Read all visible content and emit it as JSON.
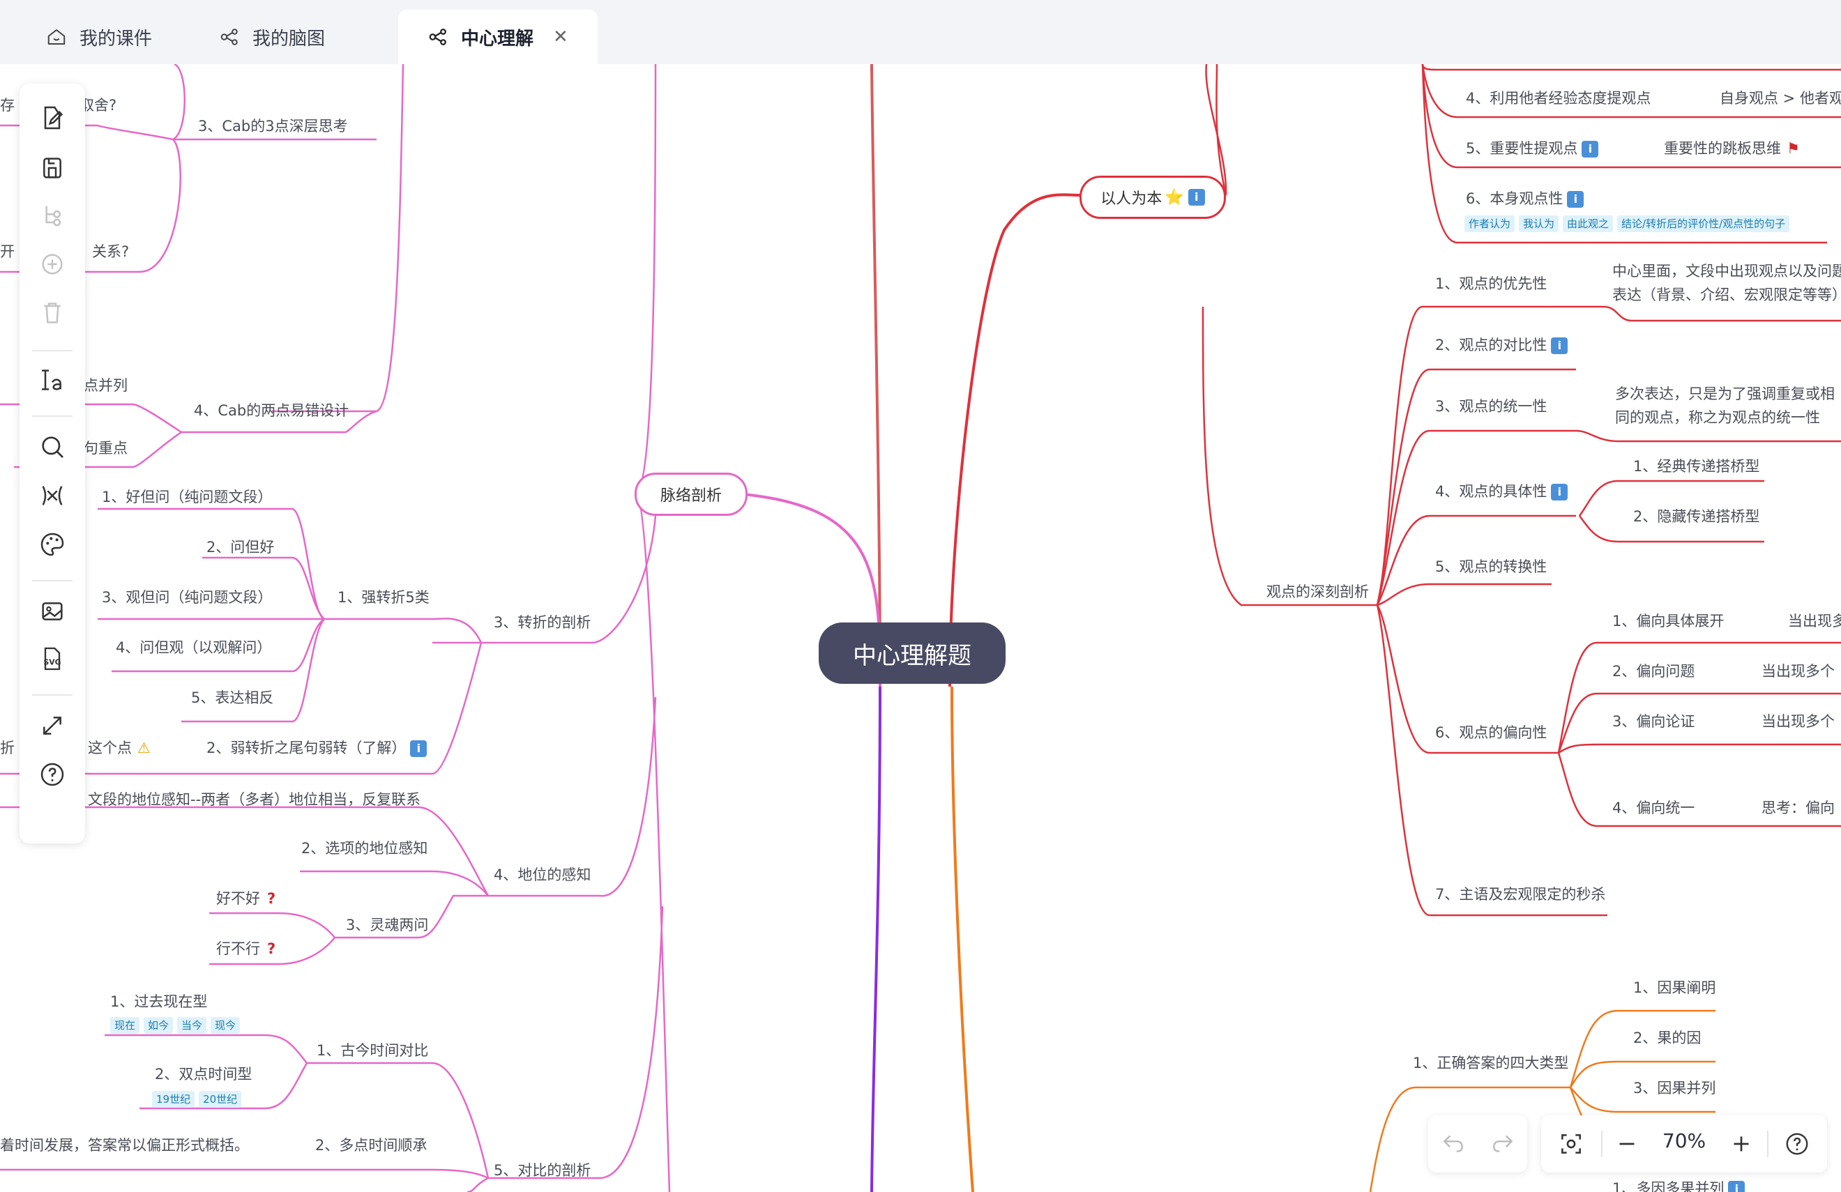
{
  "tabs": [
    {
      "label": "我的课件",
      "icon": "home-icon"
    },
    {
      "label": "我的脑图",
      "icon": "mindmap-icon"
    },
    {
      "label": "中心理解",
      "icon": "mindmap-icon",
      "active": true
    }
  ],
  "root": "中心理解题",
  "left": {
    "main_nodes": {
      "mailuo": "脉络剖析"
    },
    "cab": {
      "deep": "3、Cab的3点深层思考",
      "easy": "4、Cab的两点易错设计",
      "frag_1": "存",
      "frag_2": "取舍?",
      "frag_3": "开",
      "frag_4": "关系?",
      "frag_5": "点并列",
      "frag_6": "句重点"
    },
    "zhuanzhe": {
      "title": "3、转折的剖析",
      "strong": "1、强转折5类",
      "items": [
        "1、好但问（纯问题文段）",
        "2、问但好",
        "3、观但问（纯问题文段）",
        "4、问但观（以观解问）",
        "5、表达相反"
      ],
      "weak": "2、弱转折之尾句弱转（了解）",
      "frag_a": "折",
      "frag_b": "这个点"
    },
    "diwei": {
      "title": "4、地位的感知",
      "item1": "文段的地位感知--两者（多者）地位相当，反复联系",
      "item2": "2、选项的地位感知",
      "soul": "3、灵魂两问",
      "q1": "好不好",
      "q2": "行不行"
    },
    "duibi": {
      "title": "5、对比的剖析",
      "ancient": "1、古今时间对比",
      "past_now": "1、过去现在型",
      "past_tags": [
        "现在",
        "如今",
        "当今",
        "现今"
      ],
      "two_point": "2、双点时间型",
      "two_tags": [
        "19世纪",
        "20世纪"
      ],
      "multi": "2、多点时间顺承",
      "multi_desc": "着时间发展，答案常以偏正形式概括。"
    }
  },
  "right": {
    "yirenweiben": {
      "title": "以人为本",
      "item4": "4、利用他者经验态度提观点",
      "item4_note": "自身观点 > 他者观",
      "item5": "5、重要性提观点",
      "item5_note": "重要性的跳板思维",
      "item6": "6、本身观点性",
      "item6_tags": [
        "作者认为",
        "我认为",
        "由此观之",
        "结论/转折后的评价性/观点性的句子"
      ]
    },
    "guandian": {
      "title": "观点的深刻剖析",
      "item1": "1、观点的优先性",
      "item1_note_l1": "中心里面，文段中出现观点以及问题",
      "item1_note_l2": "表达（背景、介绍、宏观限定等等）",
      "item2": "2、观点的对比性",
      "item3": "3、观点的统一性",
      "item3_note_l1": "多次表达，只是为了强调重复或相",
      "item3_note_l2": "同的观点，称之为观点的统一性",
      "item4": "4、观点的具体性",
      "item4_sub": [
        "1、经典传递搭桥型",
        "2、隐藏传递搭桥型"
      ],
      "item5": "5、观点的转换性",
      "item6": "6、观点的偏向性",
      "item6_sub": [
        "1、偏向具体展开",
        "2、偏向问题",
        "3、偏向论证",
        "4、偏向统一"
      ],
      "item6_notes": [
        "当出现多",
        "当出现多个",
        "当出现多个",
        "思考：偏向"
      ],
      "item7": "7、主语及宏观限定的秒杀"
    },
    "zhengque": {
      "title": "1、正确答案的四大类型",
      "items": [
        "1、因果阐明",
        "2、果的因",
        "3、因果并列"
      ],
      "frag": "1、多因多果并列"
    }
  },
  "toolbar": {
    "buttons": [
      {
        "name": "edit-icon"
      },
      {
        "name": "save-icon"
      },
      {
        "name": "add-child-icon"
      },
      {
        "name": "add-node-icon"
      },
      {
        "name": "delete-icon"
      },
      {
        "name": "text-style-icon"
      },
      {
        "name": "search-icon"
      },
      {
        "name": "structure-icon"
      },
      {
        "name": "palette-icon"
      },
      {
        "name": "image-icon"
      },
      {
        "name": "svg-export-icon"
      },
      {
        "name": "fullscreen-icon"
      },
      {
        "name": "help-icon"
      }
    ],
    "svg_label": "SVG"
  },
  "zoom": {
    "value": "70%"
  },
  "colors": {
    "pink": "#e667c9",
    "red": "#e0303b",
    "orange": "#f07a1b",
    "purple": "#8a2be2",
    "root_bg": "#484a63"
  }
}
